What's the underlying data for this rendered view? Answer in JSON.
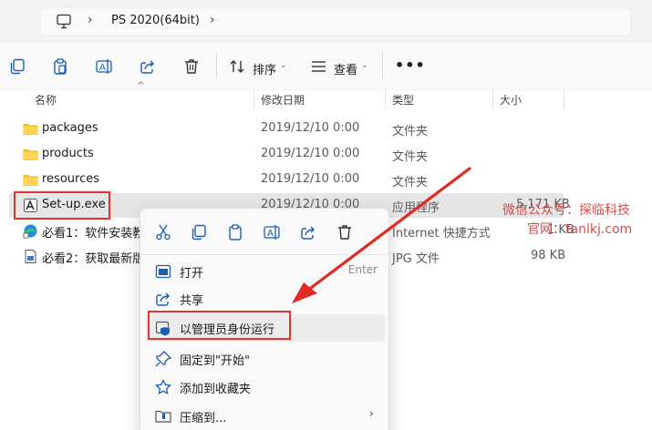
{
  "address": {
    "breadcrumb": "PS 2020(64bit)",
    "separator": "›"
  },
  "toolbar": {
    "sort_label": "排序",
    "view_label": "查看",
    "more_label": "•••",
    "caret": "⌄"
  },
  "columns": {
    "name": "名称",
    "date": "修改日期",
    "type": "类型",
    "size": "大小"
  },
  "files": [
    {
      "name": "packages",
      "date": "2019/12/10 0:00",
      "type": "文件夹",
      "size": "",
      "icon": "folder-icon"
    },
    {
      "name": "products",
      "date": "2019/12/10 0:00",
      "type": "文件夹",
      "size": "",
      "icon": "folder-icon"
    },
    {
      "name": "resources",
      "date": "2019/12/10 0:00",
      "type": "文件夹",
      "size": "",
      "icon": "folder-icon"
    },
    {
      "name": "Set-up.exe",
      "date": "2019/12/10 0:00",
      "type": "应用程序",
      "size": "5,171 KB",
      "icon": "adobe-setup-icon",
      "selected": true
    },
    {
      "name": "必看1：软件安装教",
      "date": "",
      "type": "Internet 快捷方式",
      "size": "1 KB",
      "icon": "edge-shortcut-icon"
    },
    {
      "name": "必看2：获取最新版本",
      "date": "",
      "type": "JPG 文件",
      "size": "98 KB",
      "icon": "jpg-file-icon"
    }
  ],
  "context_menu": {
    "items": [
      {
        "label": "打开",
        "key": "Enter",
        "icon": "open-icon"
      },
      {
        "label": "共享",
        "icon": "share-icon"
      },
      {
        "label": "以管理员身份运行",
        "icon": "run-as-admin-icon",
        "highlighted": true
      },
      {
        "label": "固定到\"开始\"",
        "icon": "pin-icon"
      },
      {
        "label": "添加到收藏夹",
        "icon": "star-icon"
      },
      {
        "label": "压缩到...",
        "icon": "zip-icon",
        "submenu": "›"
      }
    ]
  },
  "watermark": {
    "line1": "微信公众号：探临科技",
    "line2": "官网：tanlkj.com"
  },
  "colors": {
    "accent": "#0067c0",
    "highlight_red": "#e8312b",
    "selected_row": "#e6e6e6"
  }
}
